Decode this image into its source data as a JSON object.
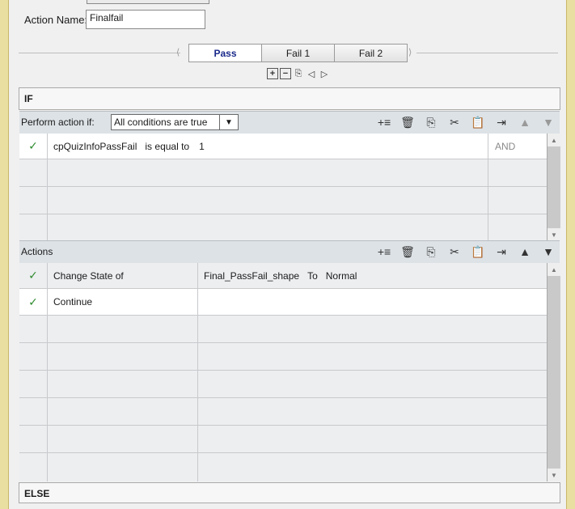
{
  "action_name": {
    "label": "Action Name:",
    "value": "Finalfail"
  },
  "tabs": [
    {
      "label": "Pass",
      "active": true
    },
    {
      "label": "Fail 1",
      "active": false
    },
    {
      "label": "Fail 2",
      "active": false
    }
  ],
  "if_section": {
    "header": "IF",
    "perform_label": "Perform action if:",
    "condition_mode": "All conditions are true",
    "conditions": [
      {
        "variable": "cpQuizInfoPassFail",
        "operator": "is equal to",
        "value": "1",
        "join": "AND"
      }
    ]
  },
  "actions_section": {
    "header": "Actions",
    "rows": [
      {
        "action": "Change State of",
        "target": "Final_PassFail_shape",
        "to_label": "To",
        "state": "Normal"
      },
      {
        "action": "Continue",
        "target": "",
        "to_label": "",
        "state": ""
      }
    ]
  },
  "else_section": {
    "header": "ELSE"
  },
  "icons": {
    "check": "✓",
    "dropdown": "▼",
    "add_row": "+≡",
    "delete": "🗑",
    "copy": "⎘",
    "cut": "✂",
    "paste": "📋",
    "insert": "⇥",
    "up": "▲",
    "down": "▼",
    "tab_add": "+",
    "tab_remove": "−",
    "tab_copy": "⎘",
    "tab_left": "◁",
    "tab_right": "▷",
    "scroll_up": "▲",
    "scroll_down": "▼"
  },
  "colors": {
    "active_tab_text": "#1a2a8a",
    "check": "#2e8b2e",
    "frame": "#e8dfa0"
  }
}
